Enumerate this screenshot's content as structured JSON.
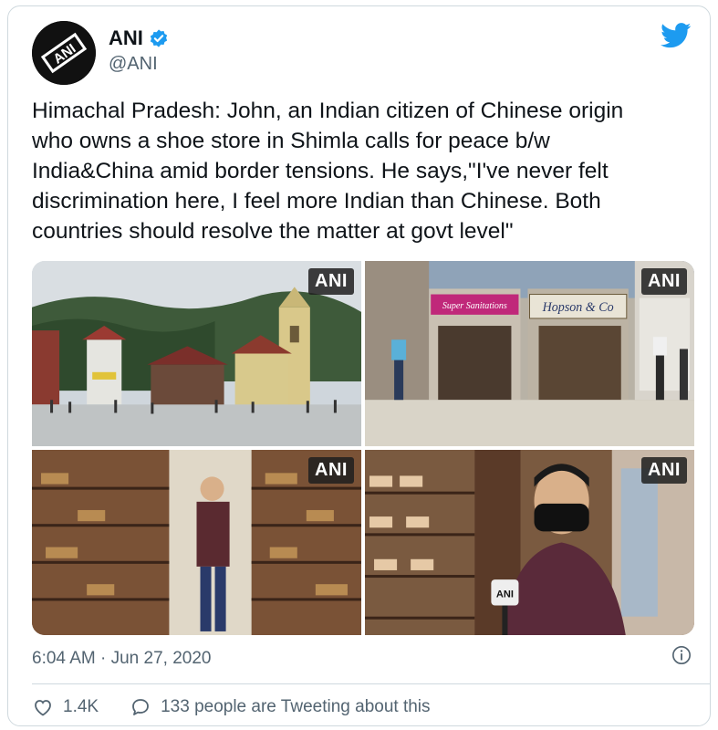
{
  "author": {
    "avatar_text": "ANI",
    "name": "ANI",
    "handle": "@ANI",
    "verified": true
  },
  "tweet": {
    "text": "Himachal Pradesh: John, an Indian citizen of Chinese origin\nwho owns a shoe store in Shimla calls for peace b/w\nIndia&China amid border tensions. He says,\"I've never felt\ndiscrimination here, I feel more Indian than Chinese. Both\ncountries should resolve the matter at govt level\"",
    "timestamp": "6:04 AM · Jun 27, 2020"
  },
  "media": {
    "watermark": "ANI",
    "photos": [
      {
        "scene": "shimla-mall-road-church"
      },
      {
        "scene": "street-shops-super-sanitations-hopson-co"
      },
      {
        "scene": "man-standing-in-shoe-store"
      },
      {
        "scene": "man-with-mask-and-ani-mic"
      }
    ],
    "shop_signs": {
      "sign1": "Super Sanitations",
      "sign2": "Hopson & Co",
      "mic_label": "ANI"
    }
  },
  "stats": {
    "likes": "1.4K",
    "conversation": "133 people are Tweeting about this"
  },
  "icons": {
    "brand_color": "#1d9bf0",
    "verified_color": "#1d9bf0",
    "like": "heart-icon",
    "reply": "speech-bubble-icon",
    "info": "info-icon",
    "logo": "twitter-bird-icon"
  }
}
